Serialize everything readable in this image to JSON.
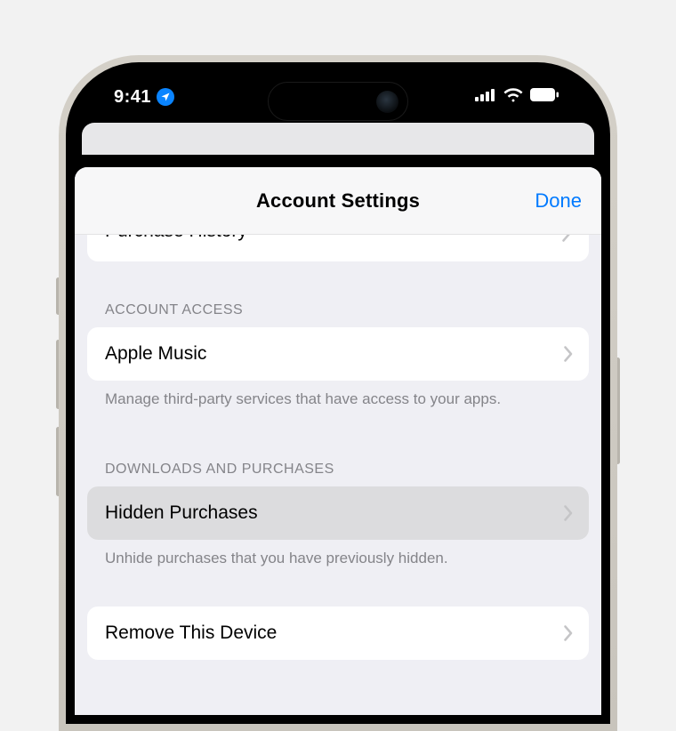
{
  "status": {
    "time": "9:41",
    "location_icon": "location-arrow-icon"
  },
  "nav": {
    "title": "Account Settings",
    "done": "Done"
  },
  "peek_row": {
    "label": "Purchase History"
  },
  "sections": {
    "account_access": {
      "header": "ACCOUNT ACCESS",
      "row": {
        "label": "Apple Music"
      },
      "footer": "Manage third-party services that have access to your apps."
    },
    "downloads": {
      "header": "DOWNLOADS AND PURCHASES",
      "row": {
        "label": "Hidden Purchases"
      },
      "footer": "Unhide purchases that you have previously hidden."
    },
    "remove": {
      "row": {
        "label": "Remove This Device"
      }
    }
  }
}
